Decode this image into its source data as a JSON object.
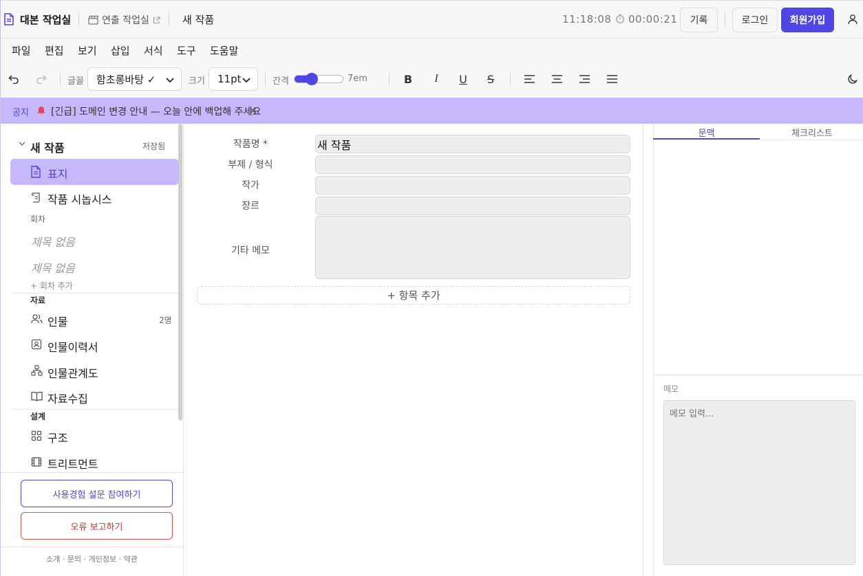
{
  "app": {
    "title": "대본 작업실",
    "linked_app": "연출 작업실",
    "doc_title": "새 작품",
    "clock": "11:18:08",
    "timer": "00:00:21",
    "history_label": "기록",
    "login_label": "로그인",
    "signup_label": "회원가입",
    "accent_color": "#4f46e5"
  },
  "menu": [
    "파일",
    "편집",
    "보기",
    "삽입",
    "서식",
    "도구",
    "도움말"
  ],
  "toolbar": {
    "font_label": "글꼴",
    "font_value": "함초롱바탕 ✓",
    "size_label": "크기",
    "size_value": "11pt",
    "spacing_label": "간격",
    "spacing_value": "7em",
    "spacing_level": 0.3,
    "bold": "B",
    "italic": "I",
    "underline": "U",
    "strike": "S"
  },
  "notice": {
    "tag": "공지",
    "text": "[긴급] 도메인 변경 안내 — 오늘 안에 백업해 주세요",
    "close": "×",
    "color": "#c6b8fb"
  },
  "sidebar": {
    "project_title": "새 작품",
    "save_status": "저장됨",
    "cover": "표지",
    "synopsis": "작품 시놉시스",
    "episodes_header": "회차",
    "episodes": [
      "제목 없음",
      "제목 없음"
    ],
    "add_episode": "+ 회차 추가",
    "materials_header": "자료",
    "characters": "인물",
    "characters_count": "2명",
    "character_profile": "인물이력서",
    "relationship_map": "인물관계도",
    "research": "자료수집",
    "design_header": "설계",
    "structure": "구조",
    "treatment": "트리트먼트",
    "survey_button": "사용경험 설문 참여하기",
    "bug_button": "오류 보고하기",
    "footer": "소개 · 문의 · 개인정보 · 약관"
  },
  "form": {
    "title_label": "작품명 *",
    "title_value": "새 작품",
    "subtitle_label": "부제 / 형식",
    "subtitle_value": "",
    "author_label": "작가",
    "author_value": "",
    "genre_label": "장르",
    "genre_value": "",
    "memo_label": "기타 메모",
    "memo_value": "",
    "add_field": "+ 항목 추가"
  },
  "right": {
    "tab_context": "문맥",
    "tab_checklist": "체크리스트",
    "memo_label": "메모",
    "memo_placeholder": "메모 입력..."
  }
}
